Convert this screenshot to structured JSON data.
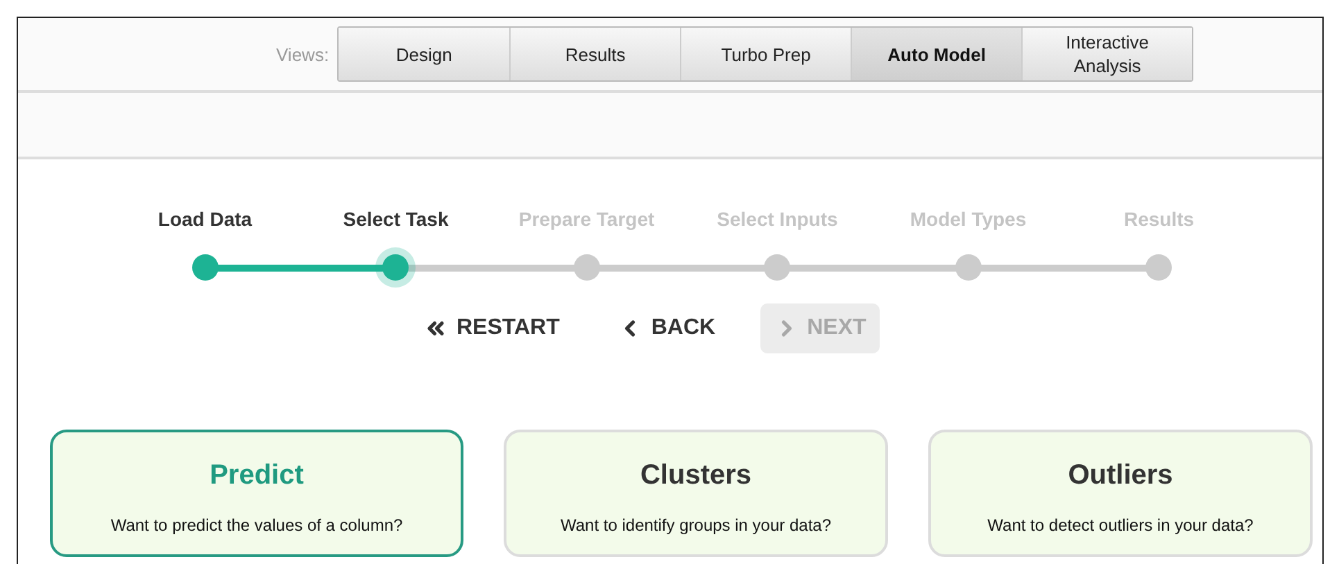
{
  "views": {
    "label": "Views:",
    "tabs": [
      {
        "label": "Design",
        "selected": false
      },
      {
        "label": "Results",
        "selected": false
      },
      {
        "label": "Turbo Prep",
        "selected": false
      },
      {
        "label": "Auto Model",
        "selected": true
      },
      {
        "label": "Interactive Analysis",
        "selected": false
      }
    ]
  },
  "steps": [
    {
      "label": "Load Data",
      "done": true,
      "selected": false
    },
    {
      "label": "Select Task",
      "done": false,
      "selected": true
    },
    {
      "label": "Prepare Target",
      "done": false,
      "selected": false
    },
    {
      "label": "Select Inputs",
      "done": false,
      "selected": false
    },
    {
      "label": "Model Types",
      "done": false,
      "selected": false
    },
    {
      "label": "Results",
      "done": false,
      "selected": false
    }
  ],
  "nav": [
    {
      "kind": "restart",
      "label": "RESTART",
      "disabled": false
    },
    {
      "kind": "back",
      "label": "BACK",
      "disabled": false
    },
    {
      "kind": "next",
      "label": "NEXT",
      "disabled": true
    }
  ],
  "tasks": [
    {
      "title": "Predict",
      "description": "Want to predict the values of a column?",
      "selected": true
    },
    {
      "title": "Clusters",
      "description": "Want to identify groups in your data?",
      "selected": false
    },
    {
      "title": "Outliers",
      "description": "Want to detect outliers in your data?",
      "selected": false
    }
  ]
}
